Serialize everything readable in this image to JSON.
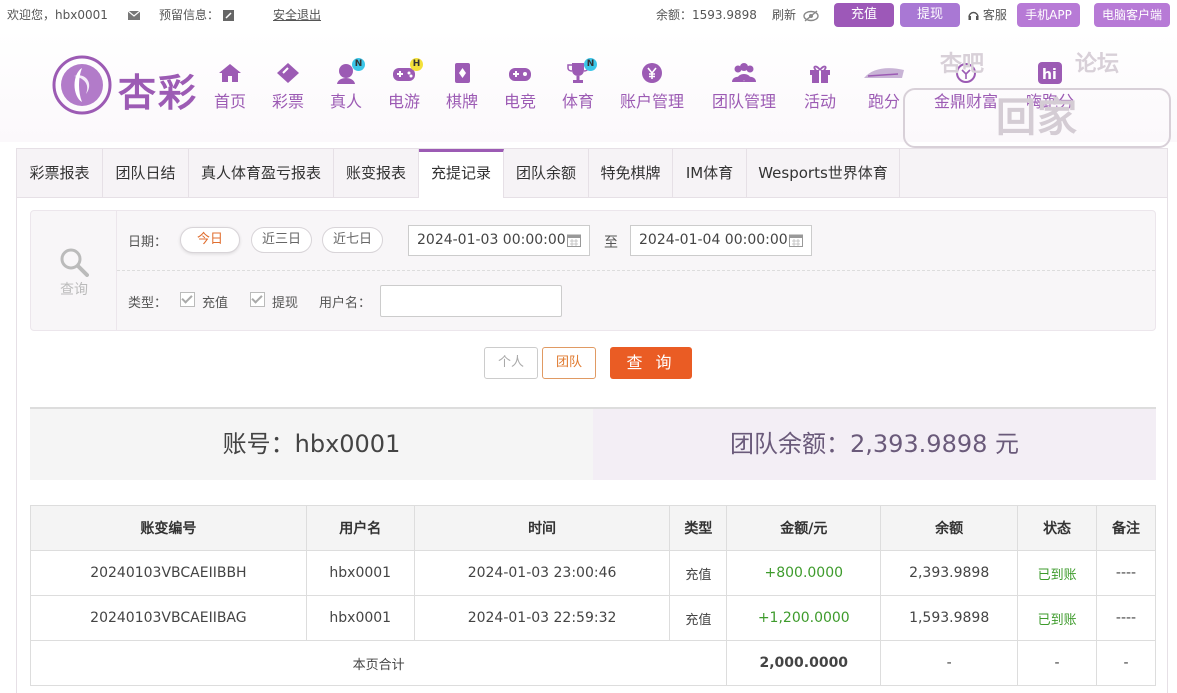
{
  "topbar": {
    "welcome": "欢迎您，hbx0001",
    "reserve_label": "预留信息：",
    "logout": "安全退出",
    "balance": "余额：1593.9898",
    "refresh": "刷新",
    "deposit": "充值",
    "withdraw": "提现",
    "service": "客服",
    "mobile_app": "手机APP",
    "pc_client": "电脑客户端"
  },
  "logo": {
    "text": "杏彩"
  },
  "nav": [
    {
      "label": "首页",
      "icon": "home-icon"
    },
    {
      "label": "彩票",
      "icon": "lottery-icon"
    },
    {
      "label": "真人",
      "icon": "live-dealer-icon",
      "badge": "N"
    },
    {
      "label": "电游",
      "icon": "gamepad-icon",
      "badge": "H"
    },
    {
      "label": "棋牌",
      "icon": "cards-icon"
    },
    {
      "label": "电竞",
      "icon": "esports-icon"
    },
    {
      "label": "体育",
      "icon": "trophy-icon",
      "badge": "N"
    },
    {
      "label": "账户管理",
      "icon": "yen-coin-icon"
    },
    {
      "label": "团队管理",
      "icon": "team-icon"
    },
    {
      "label": "活动",
      "icon": "gift-icon"
    },
    {
      "label": "跑分",
      "icon": "running-icon"
    },
    {
      "label": "金鼎财富",
      "icon": "wealth-icon"
    },
    {
      "label": "嗨跑分",
      "icon": "hi-icon"
    }
  ],
  "watermark": {
    "line1": "杏吧",
    "line1b": "论坛",
    "line2": "回家205.com"
  },
  "tabs": [
    "彩票报表",
    "团队日结",
    "真人体育盈亏报表",
    "账变报表",
    "充提记录",
    "团队余额",
    "特免棋牌",
    "IM体育",
    "Wesports世界体育"
  ],
  "filter": {
    "query_label": "查询",
    "date_label": "日期：",
    "today": "今日",
    "three_days": "近三日",
    "seven_days": "近七日",
    "start_date": "2024-01-03 00:00:00",
    "to": "至",
    "end_date": "2024-01-04 00:00:00",
    "type_label": "类型：",
    "type_deposit": "充值",
    "type_withdraw": "提现",
    "username_label": "用户名：",
    "username_value": ""
  },
  "actions": {
    "personal": "个人",
    "team": "团队",
    "query": "查 询"
  },
  "summary": {
    "account": "账号：hbx0001",
    "team_balance": "团队余额：2,393.9898 元"
  },
  "table": {
    "headers": [
      "账变编号",
      "用户名",
      "时间",
      "类型",
      "金额/元",
      "余额",
      "状态",
      "备注"
    ],
    "rows": [
      [
        "20240103VBCAEIIBBH",
        "hbx0001",
        "2024-01-03 23:00:46",
        "充值",
        "+800.0000",
        "2,393.9898",
        "已到账",
        "----"
      ],
      [
        "20240103VBCAEIIBAG",
        "hbx0001",
        "2024-01-03 22:59:32",
        "充值",
        "+1,200.0000",
        "1,593.9898",
        "已到账",
        "----"
      ]
    ],
    "footer": {
      "label": "本页合计",
      "amount": "2,000.0000",
      "balance": "-",
      "status": "-",
      "note": "-"
    }
  },
  "colors": {
    "brand": "#9c5bb4",
    "accent": "#ea5c24",
    "success": "#3e9b2c",
    "balance": "#e84c3d"
  }
}
